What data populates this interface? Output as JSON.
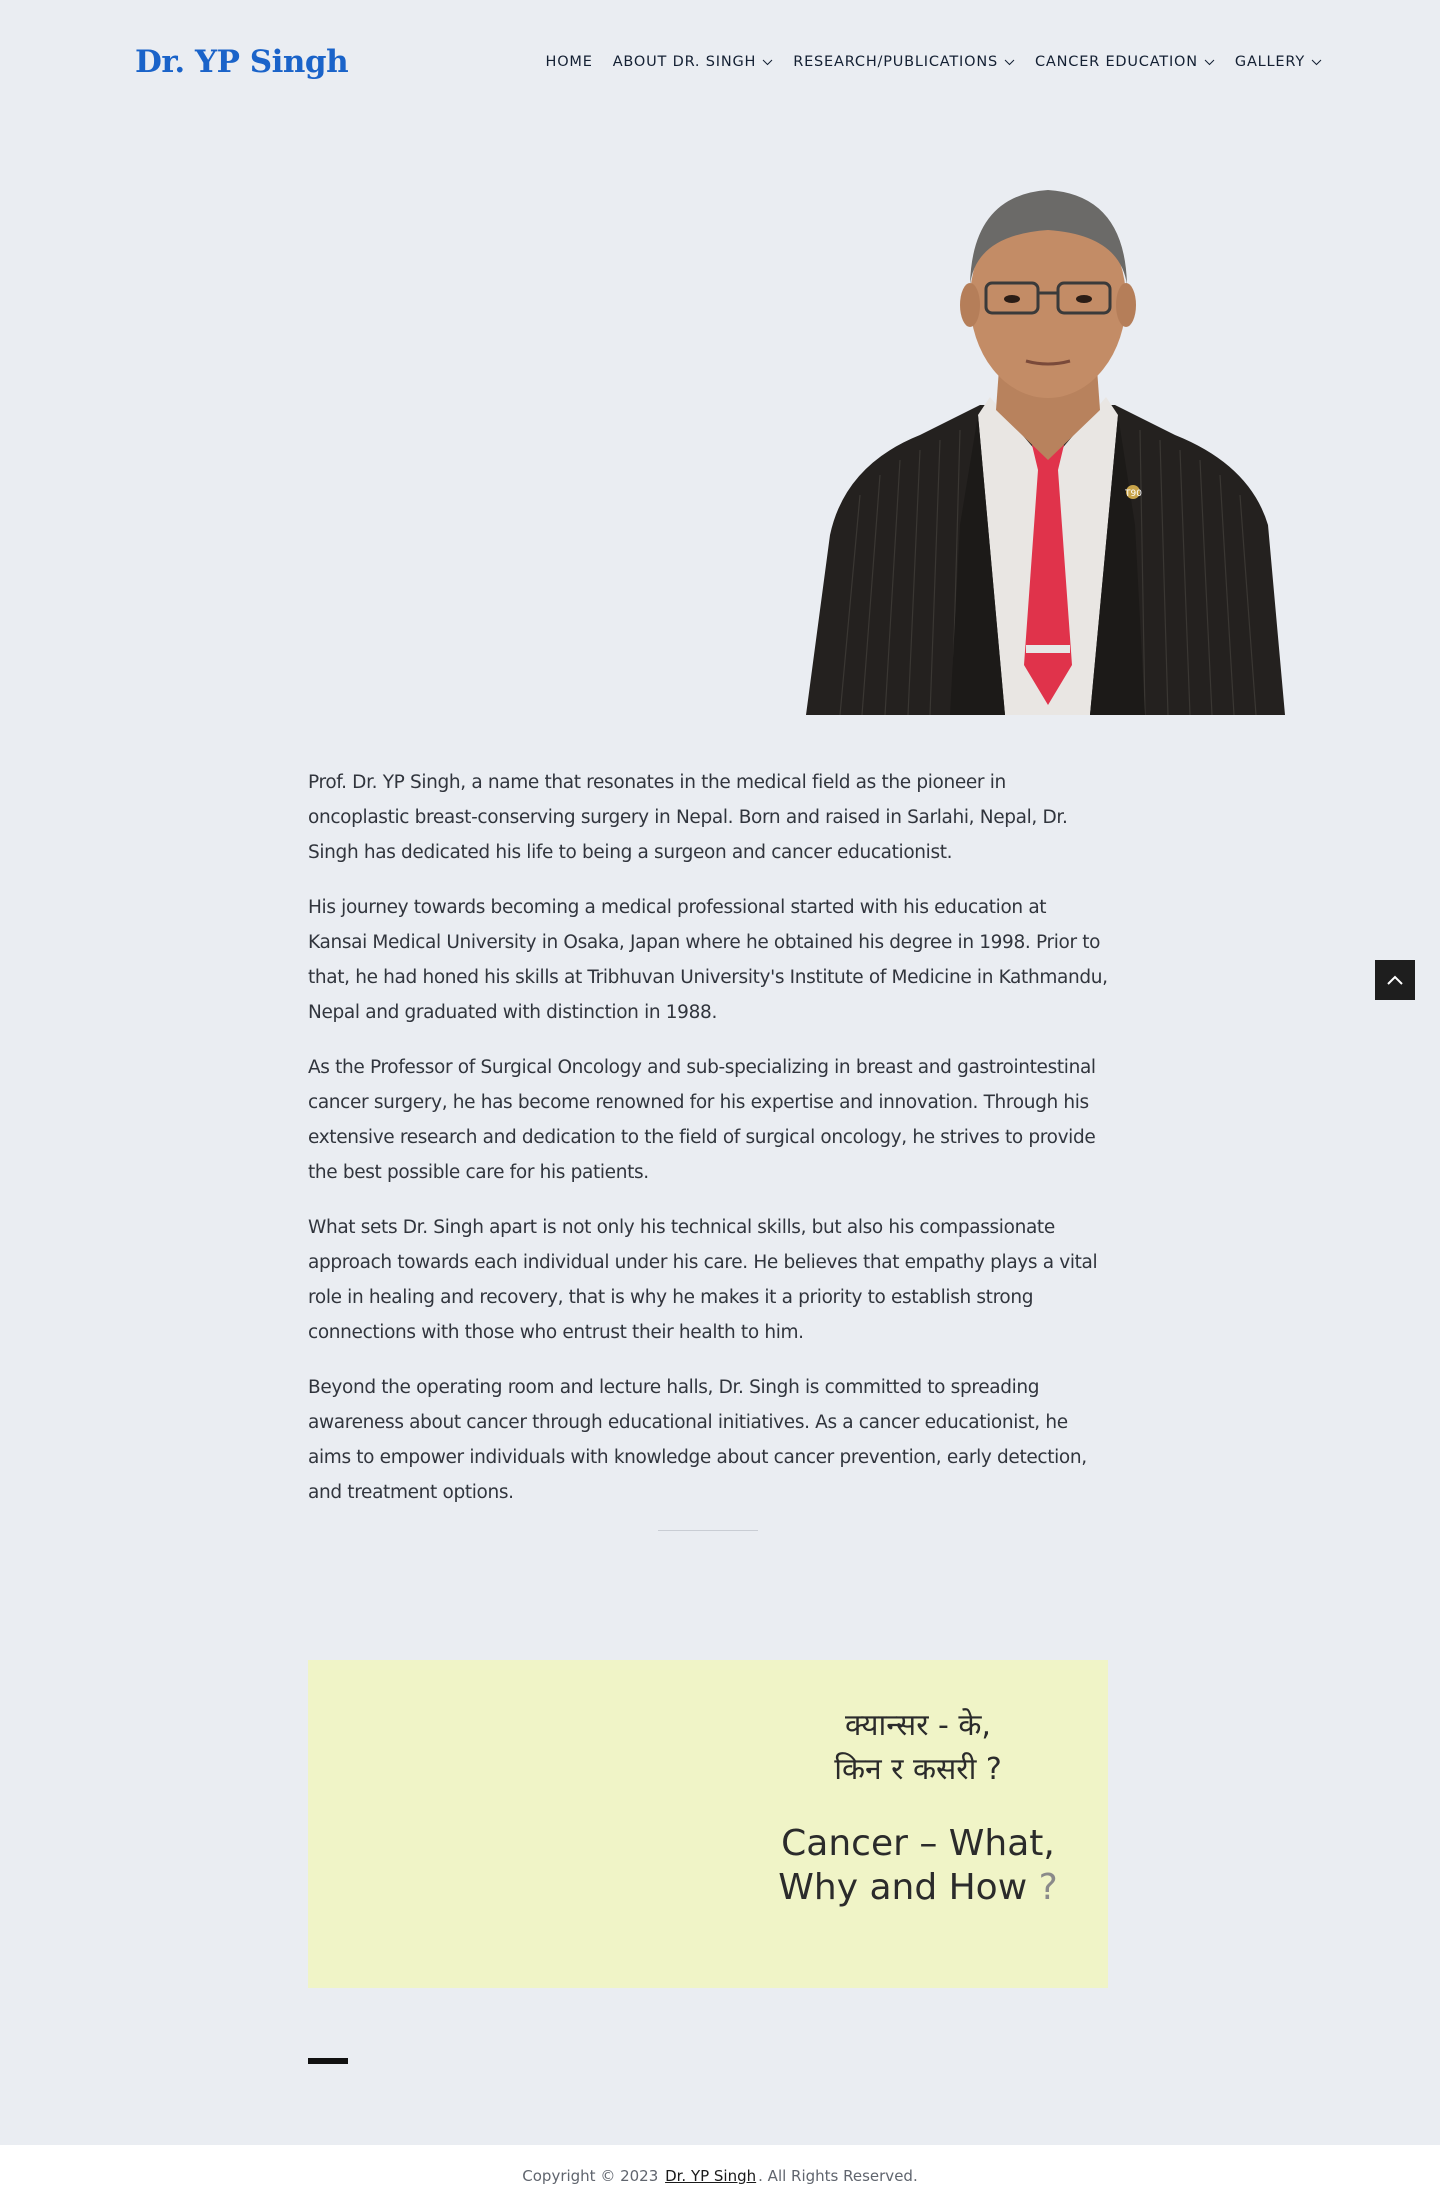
{
  "header": {
    "logo": "Dr. YP Singh",
    "nav": [
      {
        "label": "HOME",
        "has_dropdown": false
      },
      {
        "label": "ABOUT DR. SINGH",
        "has_dropdown": true
      },
      {
        "label": "RESEARCH/PUBLICATIONS",
        "has_dropdown": true
      },
      {
        "label": "CANCER EDUCATION",
        "has_dropdown": true
      },
      {
        "label": "GALLERY",
        "has_dropdown": true
      }
    ]
  },
  "portrait": {
    "pin_text": "T90"
  },
  "bio": {
    "paragraphs": [
      "Prof. Dr. YP Singh, a name that resonates in the medical field as the pioneer in oncoplastic breast-conserving surgery in Nepal. Born and raised in Sarlahi, Nepal, Dr. Singh has dedicated his life to being a surgeon and cancer educationist.",
      "His journey towards becoming a medical professional started with his education at Kansai Medical University in Osaka, Japan where he obtained his degree in 1998. Prior to that, he had honed his skills at Tribhuvan University's Institute of Medicine in Kathmandu, Nepal and graduated with distinction in 1988.",
      "As the Professor of Surgical Oncology and sub-specializing in breast and gastrointestinal cancer surgery, he has become renowned for his expertise and innovation. Through his extensive research and dedication to the field of surgical oncology, he strives to provide the best possible care for his patients.",
      "What sets Dr. Singh apart is not only his technical skills, but also his compassionate approach towards each individual under his care. He believes that empathy plays a vital role in healing and recovery, that is why he makes it a priority to establish strong connections with those who entrust their health to him.",
      "Beyond the operating room and lecture halls, Dr. Singh is committed to spreading awareness about cancer through educational initiatives. As a cancer educationist, he aims to empower individuals with knowledge about cancer prevention, early detection, and treatment options."
    ]
  },
  "banner": {
    "nepali_line1": "क्यान्सर - के,",
    "nepali_line2": "किन र कसरी ?",
    "english_line1": "Cancer – What,",
    "english_line2_text": "Why and How",
    "english_line2_mark": "?",
    "background_color": "#f0f4c7"
  },
  "footer": {
    "prefix": "Copyright © 2023",
    "link": "Dr. YP Singh",
    "suffix": ". All Rights Reserved."
  },
  "colors": {
    "page_bg": "#eaedf2",
    "brand": "#1a63c9",
    "to_top_bg": "#1e1e1e"
  },
  "icons": {
    "back_to_top": "chevron-up-icon",
    "dropdown": "chevron-down-icon"
  }
}
